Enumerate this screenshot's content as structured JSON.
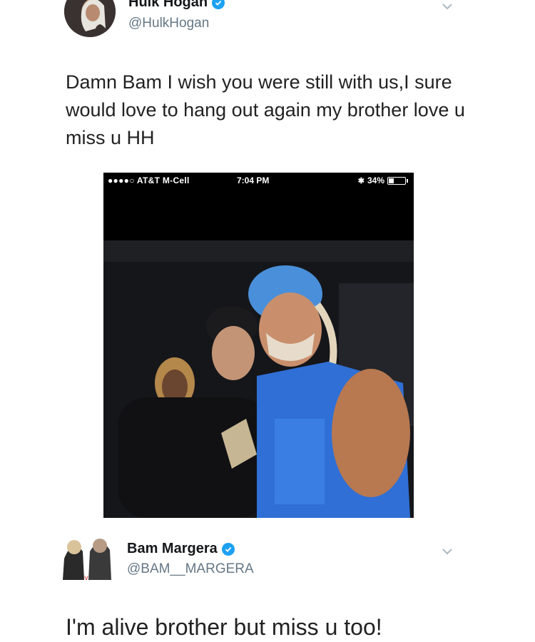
{
  "tweet1": {
    "display_name": "Hulk Hogan",
    "handle": "@HulkHogan",
    "text": "Damn  Bam I wish you were still with us,I sure would love to hang out again my brother love u miss u HH"
  },
  "embedded_screenshot": {
    "carrier": "●●●●○ AT&T M-Cell",
    "time": "7:04 PM",
    "battery": "34%",
    "battery_level": 0.34
  },
  "tweet2": {
    "display_name": "Bam Margera",
    "handle": "@BAM__MARGERA",
    "text": "I'm alive brother but miss u too!"
  },
  "colors": {
    "verified": "#1da1f2",
    "handle": "#657786",
    "text": "#14171a"
  }
}
